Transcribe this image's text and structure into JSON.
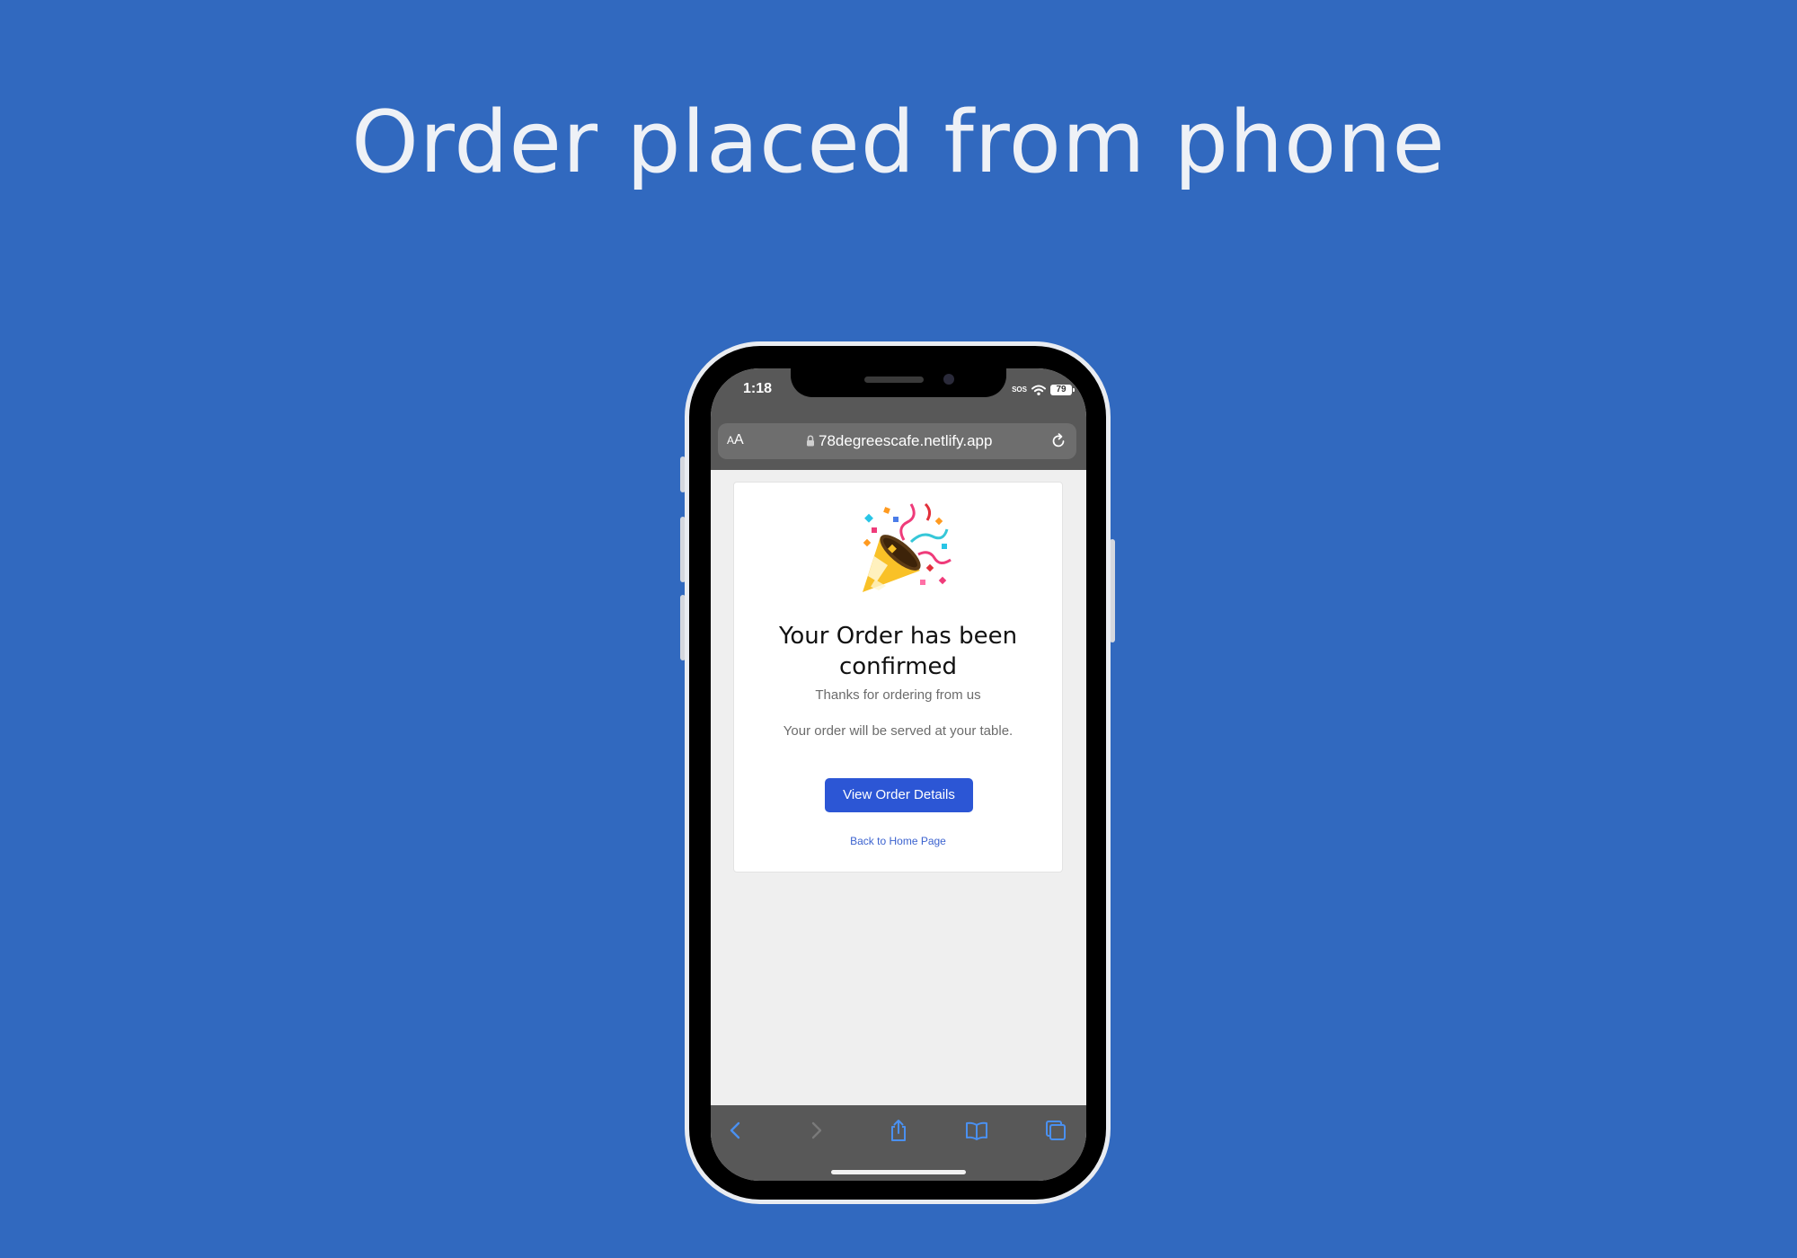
{
  "headline": "Order placed from phone",
  "phone": {
    "status_bar": {
      "time": "1:18",
      "sos": "SOS",
      "battery": "79"
    },
    "browser": {
      "text_size_button": {
        "small": "A",
        "large": "A"
      },
      "url": "78degreescafe.netlify.app"
    },
    "page": {
      "title": "Your Order has been confirmed",
      "subtitle": "Thanks for ordering from us",
      "message": "Your order will be served at your table.",
      "primary_button": "View Order Details",
      "link": "Back to Home Page"
    },
    "toolbar_icons": [
      "back-icon",
      "forward-icon",
      "share-icon",
      "bookmarks-icon",
      "tabs-icon"
    ]
  },
  "colors": {
    "background": "#3169bf",
    "button": "#2c56d5",
    "link": "#3b62cf",
    "browser_chrome": "#585858",
    "ios_accent": "#4a90f0"
  }
}
